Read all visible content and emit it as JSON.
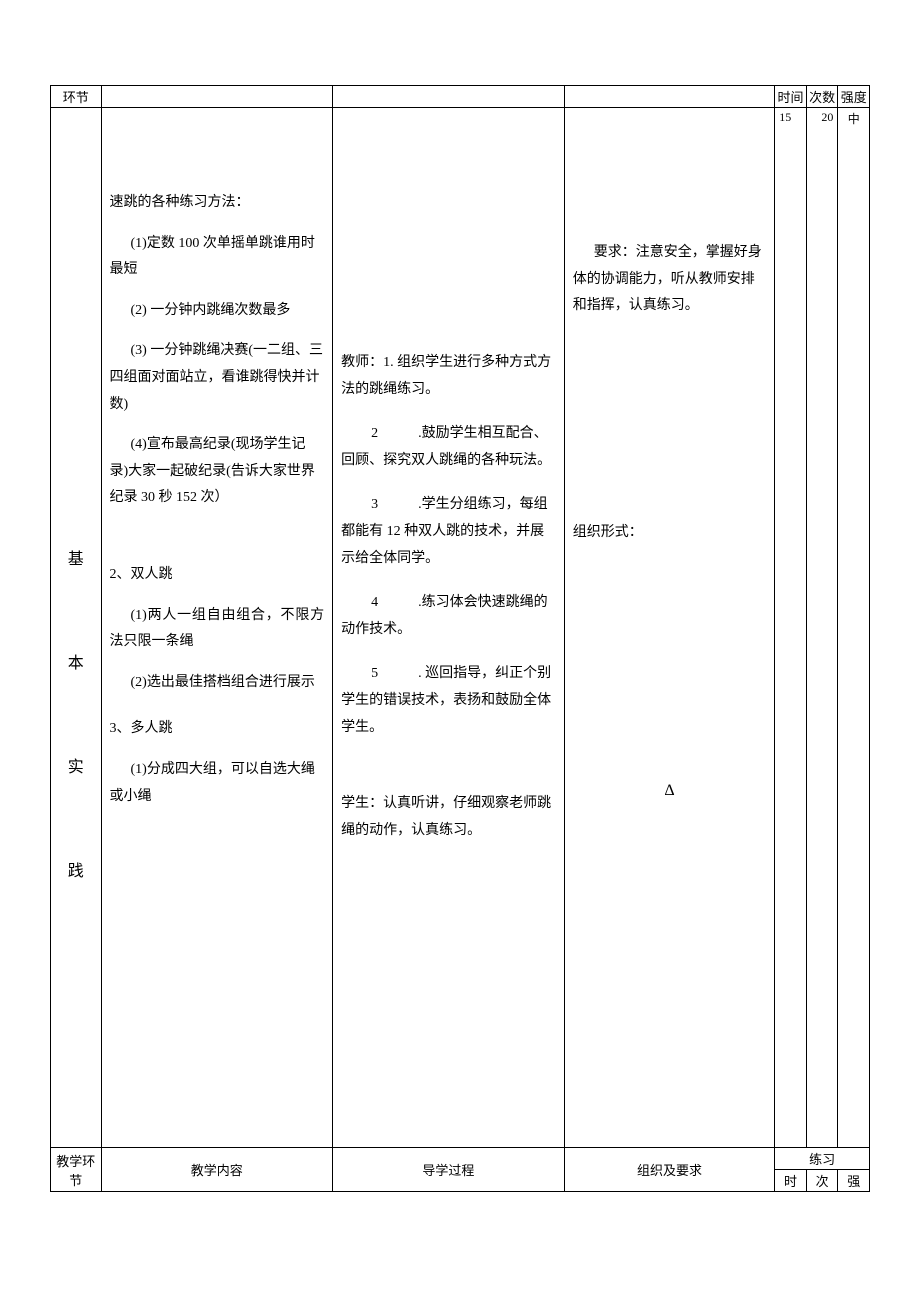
{
  "header": {
    "stage": "环节",
    "time": "时间",
    "count": "次数",
    "intensity": "强度"
  },
  "main_row": {
    "stage_chars": [
      "基",
      "本",
      "实",
      "践"
    ],
    "content": {
      "intro": "速跳的各种练习方法：",
      "p1": "(1)定数 100 次单摇单跳谁用时最短",
      "p2": "(2) 一分钟内跳绳次数最多",
      "p3": "(3) 一分钟跳绳决赛(一二组、三四组面对面站立，看谁跳得快并计数)",
      "p4": "(4)宣布最高纪录(现场学生记录)大家一起破纪录(告诉大家世界纪录 30 秒 152 次）",
      "sec2": "2、双人跳",
      "sec2_p1": "(1)两人一组自由组合，不限方法只限一条绳",
      "sec2_p2": "(2)选出最佳搭档组合进行展示",
      "sec3": "3、多人跳",
      "sec3_p1": "(1)分成四大组，可以自选大绳或小绳"
    },
    "process": {
      "t_label": "教师：1. 组织学生进行多种方式方法的跳绳练习。",
      "i2_num": "2",
      "i2_text": ".鼓励学生相互配合、回顾、探究双人跳绳的各种玩法。",
      "i3_num": "3",
      "i3_text": ".学生分组练习，每组都能有 12 种双人跳的技术，并展示给全体同学。",
      "i4_num": "4",
      "i4_text": ".练习体会快速跳绳的动作技术。",
      "i5_num": "5",
      "i5_text": ". 巡回指导，纠正个别学生的错误技术，表扬和鼓励全体学生。",
      "s_label": "学生：认真听讲，仔细观察老师跳绳的动作，认真练习。"
    },
    "org": {
      "req": "要求：注意安全，掌握好身体的协调能力，听从教师安排和指挥，认真练习。",
      "form": "组织形式：",
      "delta": "Δ"
    },
    "time": "15",
    "count": "20",
    "intensity": "中"
  },
  "footer": {
    "stage": "教学环节",
    "content": "教学内容",
    "process": "导学过程",
    "org": "组织及要求",
    "practice": "练习",
    "time": "时",
    "count": "次",
    "intensity": "强"
  }
}
